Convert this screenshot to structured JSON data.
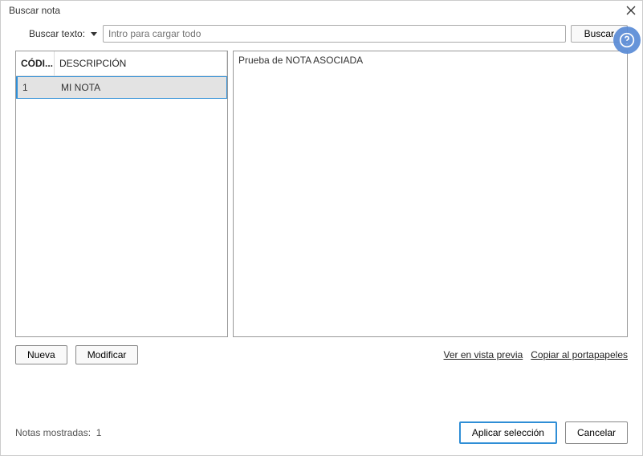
{
  "title": "Buscar nota",
  "search": {
    "label": "Buscar texto:",
    "placeholder": "Intro para cargar todo",
    "button": "Buscar"
  },
  "table": {
    "headers": {
      "code": "CÓDI...",
      "description": "DESCRIPCIÓN"
    },
    "rows": [
      {
        "code": "1",
        "description": "MI NOTA"
      }
    ]
  },
  "preview": "Prueba de NOTA ASOCIADA",
  "actions": {
    "new": "Nueva",
    "modify": "Modificar",
    "preview_link": "Ver en vista previa",
    "copy_clipboard": "Copiar al portapapeles"
  },
  "footer": {
    "count_label": "Notas mostradas:",
    "count_value": "1",
    "apply": "Aplicar selección",
    "cancel": "Cancelar"
  }
}
